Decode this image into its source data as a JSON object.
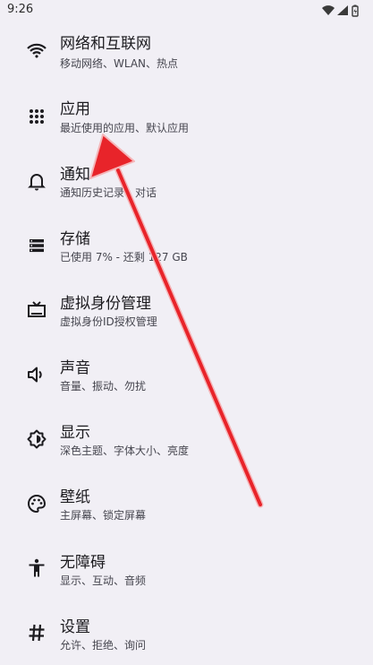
{
  "status_bar": {
    "time": "9:26",
    "icons": [
      "wifi-icon",
      "signal-icon",
      "battery-icon"
    ]
  },
  "settings": {
    "items": [
      {
        "title": "网络和互联网",
        "subtitle": "移动网络、WLAN、热点",
        "icon": "wifi-icon"
      },
      {
        "title": "应用",
        "subtitle": "最近使用的应用、默认应用",
        "icon": "apps-grid-icon"
      },
      {
        "title": "通知",
        "subtitle": "通知历史记录、对话",
        "icon": "bell-icon"
      },
      {
        "title": "存储",
        "subtitle": "已使用 7% - 还剩 127 GB",
        "icon": "storage-icon"
      },
      {
        "title": "虚拟身份管理",
        "subtitle": "虚拟身份ID授权管理",
        "icon": "tv-icon"
      },
      {
        "title": "声音",
        "subtitle": "音量、振动、勿扰",
        "icon": "speaker-icon"
      },
      {
        "title": "显示",
        "subtitle": "深色主题、字体大小、亮度",
        "icon": "brightness-icon"
      },
      {
        "title": "壁纸",
        "subtitle": "主屏幕、锁定屏幕",
        "icon": "palette-icon"
      },
      {
        "title": "无障碍",
        "subtitle": "显示、互动、音频",
        "icon": "accessibility-icon"
      },
      {
        "title": "设置",
        "subtitle": "允许、拒绝、询问",
        "icon": "hash-icon"
      }
    ]
  },
  "colors": {
    "background": "#f1eff5",
    "icon": "#1c1b1f",
    "arrow": "#e8242a"
  }
}
